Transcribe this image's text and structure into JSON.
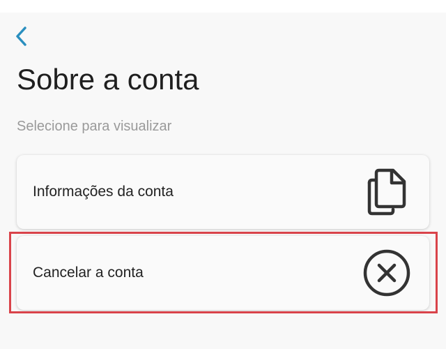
{
  "header": {
    "back_icon": "chevron-left-icon",
    "title": "Sobre a conta",
    "subtitle": "Selecione para visualizar"
  },
  "options": [
    {
      "label": "Informações da conta",
      "icon": "documents-icon"
    },
    {
      "label": "Cancelar a conta",
      "icon": "close-circle-icon"
    }
  ],
  "colors": {
    "accent": "#2a8fbf",
    "highlight": "#d9434a",
    "icon": "#333333"
  }
}
